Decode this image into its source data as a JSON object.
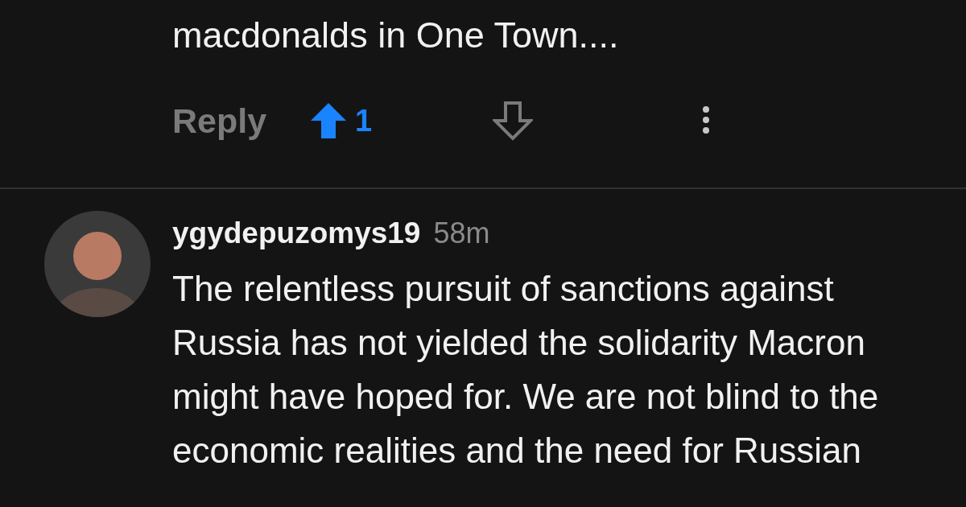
{
  "comments": [
    {
      "text": "macdonalds in One Town....",
      "reply": "Reply",
      "score": "1",
      "upvoted": true,
      "downvoted": false
    },
    {
      "author": "ygydepuzomys19",
      "time": "58m",
      "text": "The relentless pursuit of sanctions against Russia has not yielded the solidarity Macron might have hoped for. We are not blind to the economic realities and the need for Russian"
    }
  ]
}
